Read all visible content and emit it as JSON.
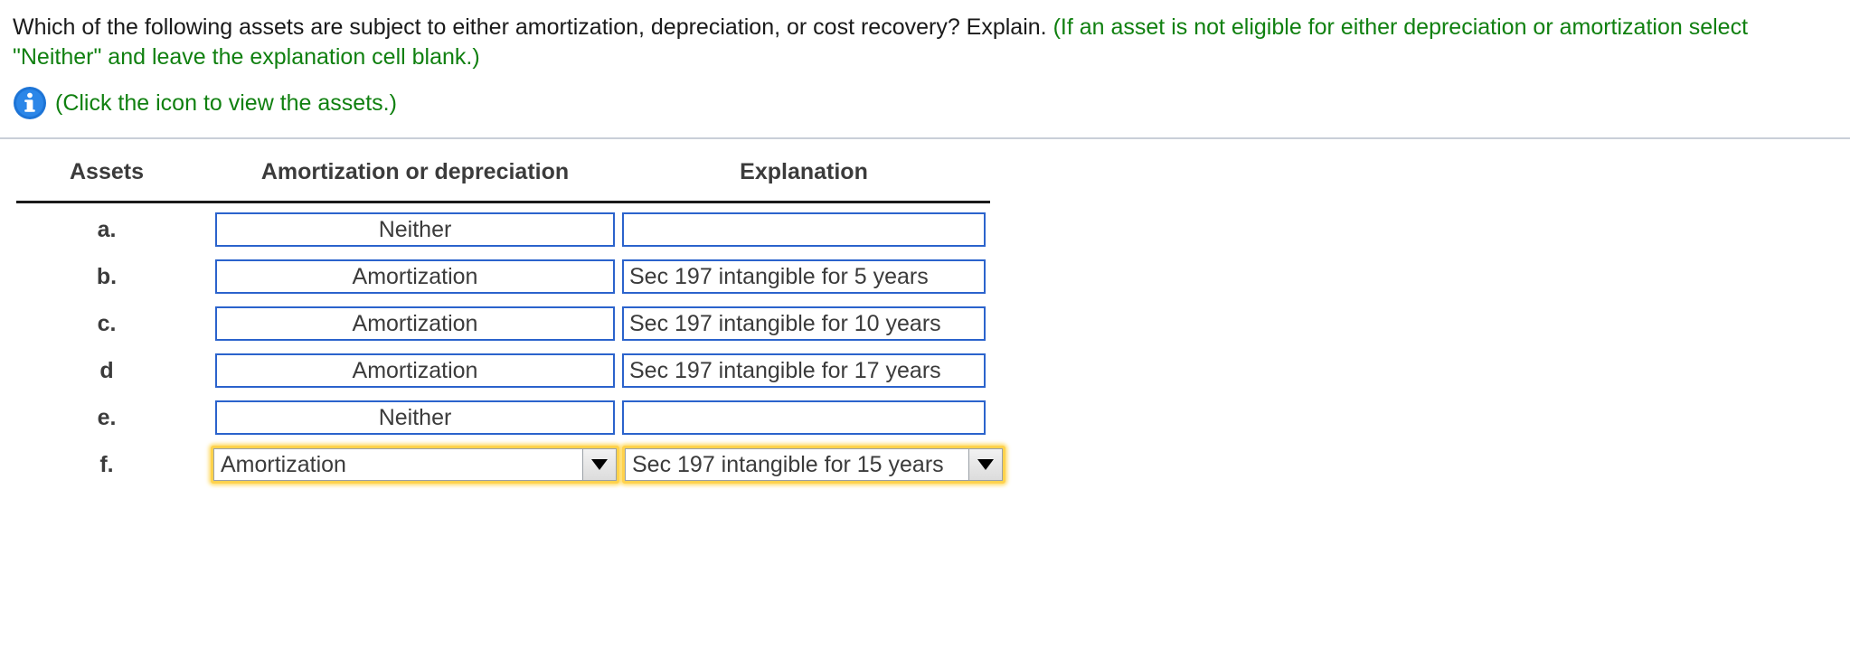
{
  "prompt": {
    "question": "Which of the following assets are subject to either amortization, depreciation, or cost recovery? Explain.",
    "hint": "(If an asset is not eligible for either depreciation or amortization select \"Neither\" and leave the explanation cell blank.)",
    "icon_caption": "(Click the icon to view the assets.)",
    "icon_name": "info-icon",
    "hint_color": "#108010",
    "icon_color": "#1d74d6"
  },
  "table": {
    "headers": {
      "assets": "Assets",
      "amortization": "Amortization or depreciation",
      "explanation": "Explanation"
    },
    "rows": [
      {
        "letter": "a.",
        "amortization": "Neither",
        "explanation": "",
        "active": false
      },
      {
        "letter": "b.",
        "amortization": "Amortization",
        "explanation": "Sec 197 intangible for 5 years",
        "active": false
      },
      {
        "letter": "c.",
        "amortization": "Amortization",
        "explanation": "Sec 197 intangible for 10 years",
        "active": false
      },
      {
        "letter": "d",
        "amortization": "Amortization",
        "explanation": "Sec 197 intangible for 17 years",
        "active": false
      },
      {
        "letter": "e.",
        "amortization": "Neither",
        "explanation": "",
        "active": false
      },
      {
        "letter": "f.",
        "amortization": "Amortization",
        "explanation": "Sec 197 intangible for 15 years",
        "active": true
      }
    ],
    "border_color": "#2b63cc",
    "active_highlight_color": "#ffd24d"
  }
}
